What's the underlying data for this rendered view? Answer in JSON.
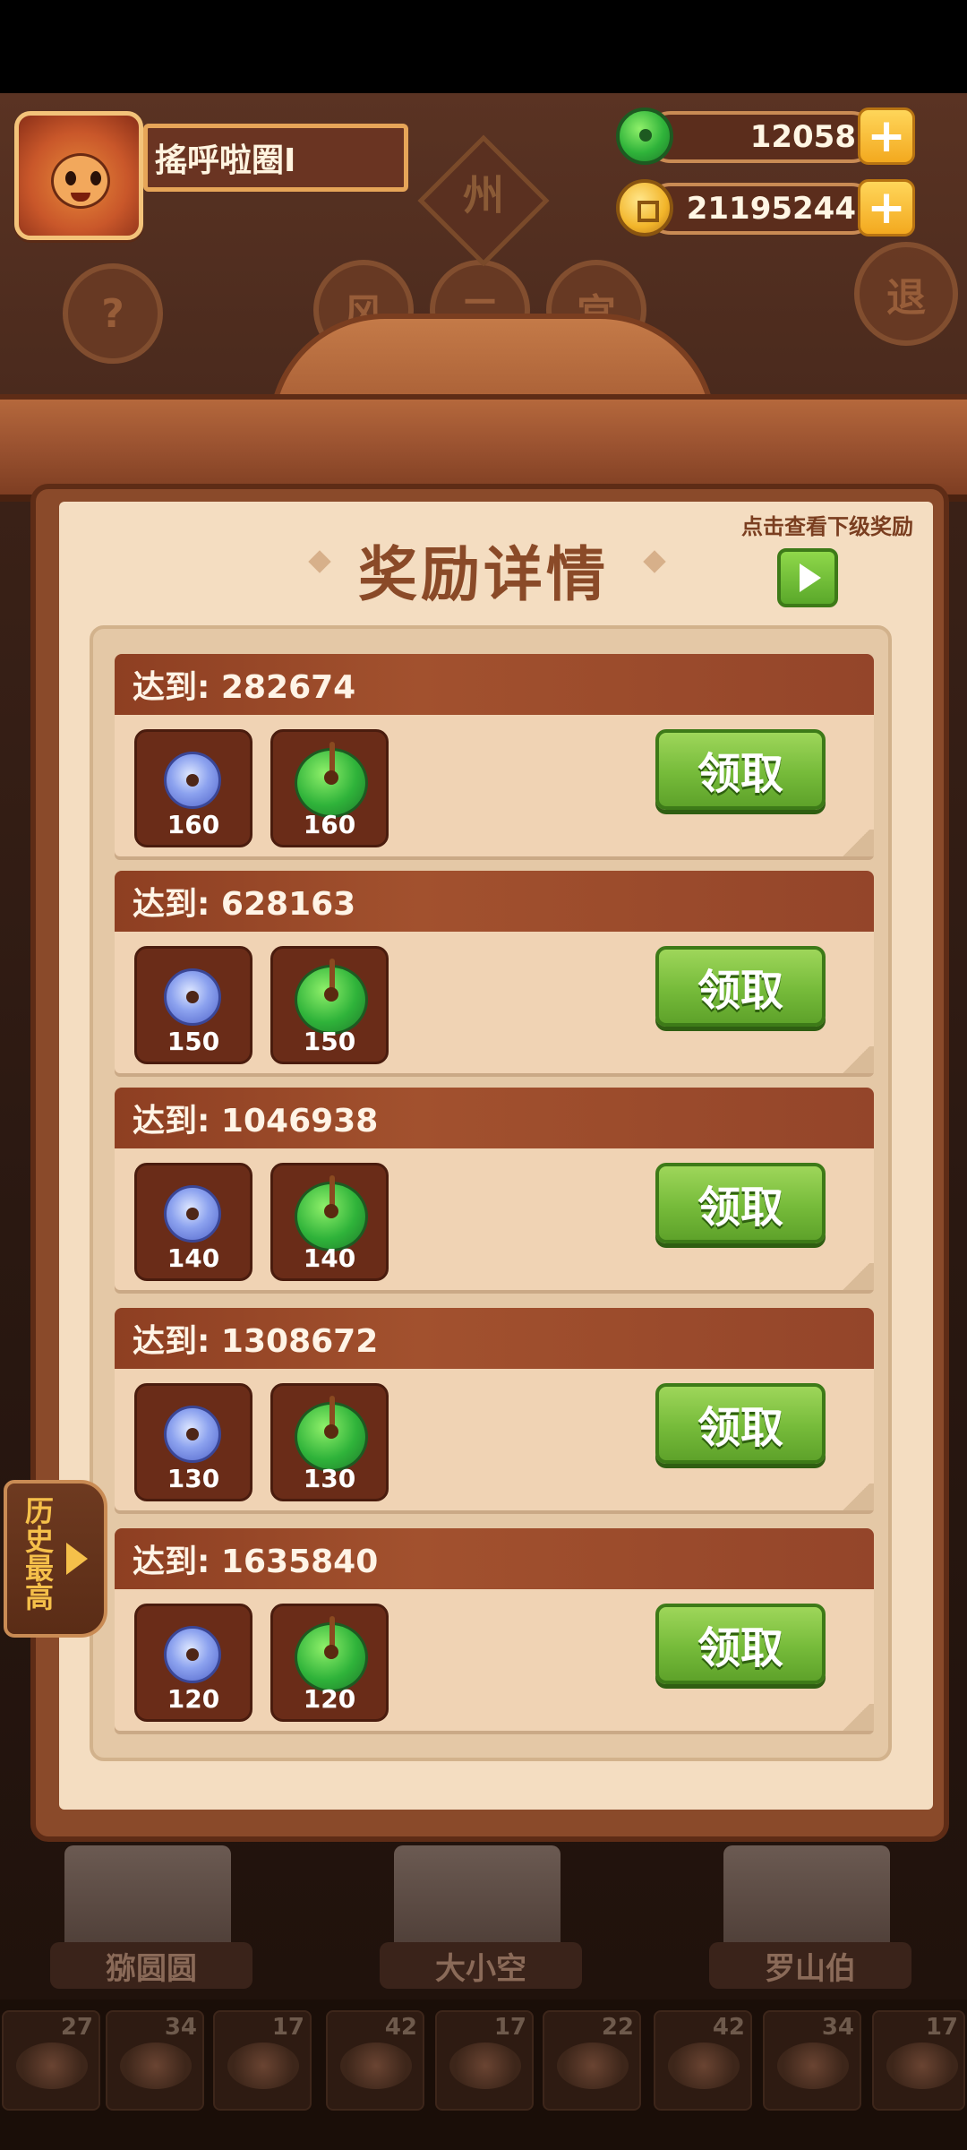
{
  "player": {
    "name": "搖呼啦圈I"
  },
  "currencies": {
    "jade": {
      "amount": "12058",
      "icon": "jade-icon"
    },
    "coins": {
      "amount": "21195244",
      "icon": "coin-icon"
    }
  },
  "background": {
    "sign": "州",
    "help_glyph": "?",
    "tab_glyphs": [
      "风",
      "二",
      "宫"
    ],
    "exit_glyph": "退"
  },
  "panel": {
    "title": "奖励详情",
    "next_level_hint": "点击查看下级奖励"
  },
  "rewards": [
    {
      "label": "达到: 282674",
      "items": [
        {
          "icon": "blue-bi-icon",
          "count": "160"
        },
        {
          "icon": "jade-icon",
          "count": "160"
        }
      ],
      "button": "领取"
    },
    {
      "label": "达到: 628163",
      "items": [
        {
          "icon": "blue-bi-icon",
          "count": "150"
        },
        {
          "icon": "jade-icon",
          "count": "150"
        }
      ],
      "button": "领取"
    },
    {
      "label": "达到: 1046938",
      "items": [
        {
          "icon": "blue-bi-icon",
          "count": "140"
        },
        {
          "icon": "jade-icon",
          "count": "140"
        }
      ],
      "button": "领取"
    },
    {
      "label": "达到: 1308672",
      "items": [
        {
          "icon": "blue-bi-icon",
          "count": "130"
        },
        {
          "icon": "jade-icon",
          "count": "130"
        }
      ],
      "button": "领取"
    },
    {
      "label": "达到: 1635840",
      "items": [
        {
          "icon": "blue-bi-icon",
          "count": "120"
        },
        {
          "icon": "jade-icon",
          "count": "120"
        }
      ],
      "button": "领取"
    }
  ],
  "history_tab": {
    "label": "历史最高"
  },
  "chefs": [
    {
      "name": "猕圆圆"
    },
    {
      "name": "大小空"
    },
    {
      "name": "罗山伯"
    }
  ],
  "dishes": [
    {
      "count": "27"
    },
    {
      "count": "34"
    },
    {
      "count": "17"
    },
    {
      "count": "42"
    },
    {
      "count": "17"
    },
    {
      "count": "22"
    },
    {
      "count": "42"
    },
    {
      "count": "34"
    },
    {
      "count": "17"
    }
  ],
  "colors": {
    "accent_green": "#76bb3a",
    "header_brown": "#8e3f22",
    "paper": "#f4ddc1",
    "gold": "#f5c04a"
  }
}
